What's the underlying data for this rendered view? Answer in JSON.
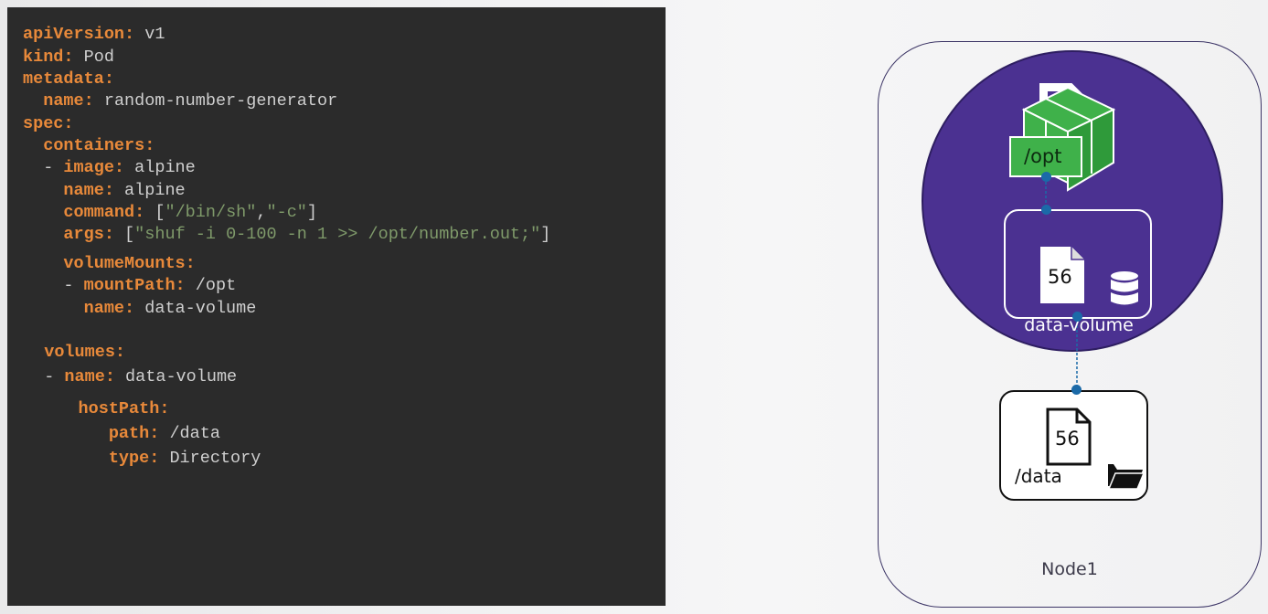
{
  "code": {
    "lines": [
      {
        "segs": [
          [
            "k",
            "apiVersion:"
          ],
          [
            "v",
            " v1"
          ]
        ]
      },
      {
        "segs": [
          [
            "k",
            "kind:"
          ],
          [
            "v",
            " Pod"
          ]
        ]
      },
      {
        "segs": [
          [
            "k",
            "metadata:"
          ]
        ]
      },
      {
        "segs": [
          [
            "v",
            "  "
          ],
          [
            "k",
            "name:"
          ],
          [
            "v",
            " random-number-generator"
          ]
        ]
      },
      {
        "segs": [
          [
            "k",
            "spec:"
          ]
        ]
      },
      {
        "segs": [
          [
            "v",
            "  "
          ],
          [
            "k",
            "containers:"
          ]
        ]
      },
      {
        "segs": [
          [
            "v",
            "  - "
          ],
          [
            "k",
            "image:"
          ],
          [
            "v",
            " alpine"
          ]
        ]
      },
      {
        "segs": [
          [
            "v",
            "    "
          ],
          [
            "k",
            "name:"
          ],
          [
            "v",
            " alpine"
          ]
        ]
      },
      {
        "segs": [
          [
            "v",
            "    "
          ],
          [
            "k",
            "command:"
          ],
          [
            "p",
            " ["
          ],
          [
            "s",
            "\"/bin/sh\""
          ],
          [
            "p",
            ","
          ],
          [
            "s",
            "\"-c\""
          ],
          [
            "p",
            "]"
          ]
        ]
      },
      {
        "segs": [
          [
            "v",
            "    "
          ],
          [
            "k",
            "args:"
          ],
          [
            "p",
            " ["
          ],
          [
            "s",
            "\"shuf -i 0-100 -n 1 >> /opt/number.out;\""
          ],
          [
            "p",
            "]"
          ]
        ]
      },
      {
        "segs": [
          [
            "v",
            "    "
          ],
          [
            "k",
            "volumeMounts:"
          ]
        ]
      },
      {
        "segs": [
          [
            "v",
            "    - "
          ],
          [
            "k",
            "mountPath:"
          ],
          [
            "v",
            " /opt"
          ]
        ]
      },
      {
        "segs": [
          [
            "v",
            "      "
          ],
          [
            "k",
            "name:"
          ],
          [
            "v",
            " data-volume"
          ]
        ]
      },
      {
        "segs": [
          [
            "v",
            "  "
          ],
          [
            "k",
            "volumes:"
          ]
        ]
      },
      {
        "segs": [
          [
            "v",
            "  - "
          ],
          [
            "k",
            "name:"
          ],
          [
            "v",
            " data-volume"
          ]
        ]
      },
      {
        "segs": [
          [
            "v",
            "    "
          ],
          [
            "k",
            "hostPath:"
          ]
        ]
      },
      {
        "segs": [
          [
            "v",
            "      "
          ],
          [
            "k",
            "path:"
          ],
          [
            "v",
            " /data"
          ]
        ]
      },
      {
        "segs": [
          [
            "v",
            "      "
          ],
          [
            "k",
            "type:"
          ],
          [
            "v",
            " Directory"
          ]
        ]
      }
    ]
  },
  "diagram": {
    "node_label": "Node1",
    "mount_path_label": "/opt",
    "volume_label": "data-volume",
    "volume_file_number": "56",
    "host_file_number": "56",
    "host_path_label": "/data",
    "colors": {
      "pod": "#4b3191",
      "container": "#3fb14a",
      "connector": "#1b6aa8",
      "node_border": "#3c3566"
    },
    "icons": [
      "container-cube-icon",
      "file-icon",
      "database-icon",
      "folder-open-icon"
    ]
  }
}
